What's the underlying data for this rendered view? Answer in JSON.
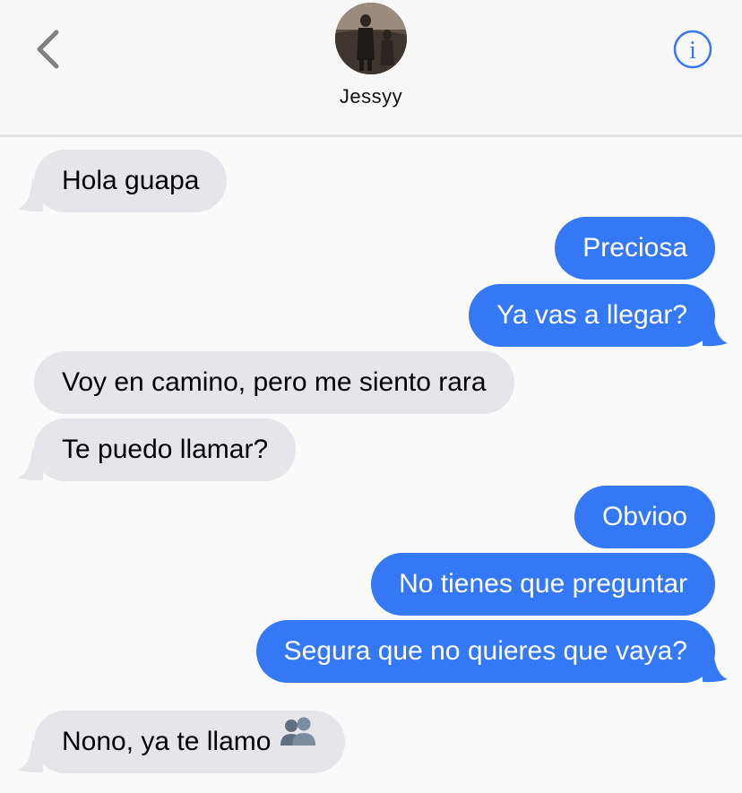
{
  "header": {
    "contact_name": "Jessyy",
    "back_icon": "chevron-left-icon",
    "info_icon": "info-circle-icon",
    "accent_color": "#3478f6"
  },
  "messages": [
    {
      "direction": "in",
      "text": "Hola guapa"
    },
    {
      "direction": "out",
      "text": "Preciosa"
    },
    {
      "direction": "out",
      "text": "Ya vas a llegar?"
    },
    {
      "direction": "in",
      "text": "Voy en camino, pero me siento rara"
    },
    {
      "direction": "in",
      "text": "Te puedo llamar?"
    },
    {
      "direction": "out",
      "text": "Obvioo"
    },
    {
      "direction": "out",
      "text": "No tienes que preguntar"
    },
    {
      "direction": "out",
      "text": "Segura que no quieres que vaya?"
    },
    {
      "direction": "in",
      "text": "Nono, ya te llamo",
      "emoji": "people-silhouette-emoji"
    }
  ],
  "colors": {
    "incoming_bubble": "#e5e5ea",
    "outgoing_bubble": "#3478f6"
  }
}
